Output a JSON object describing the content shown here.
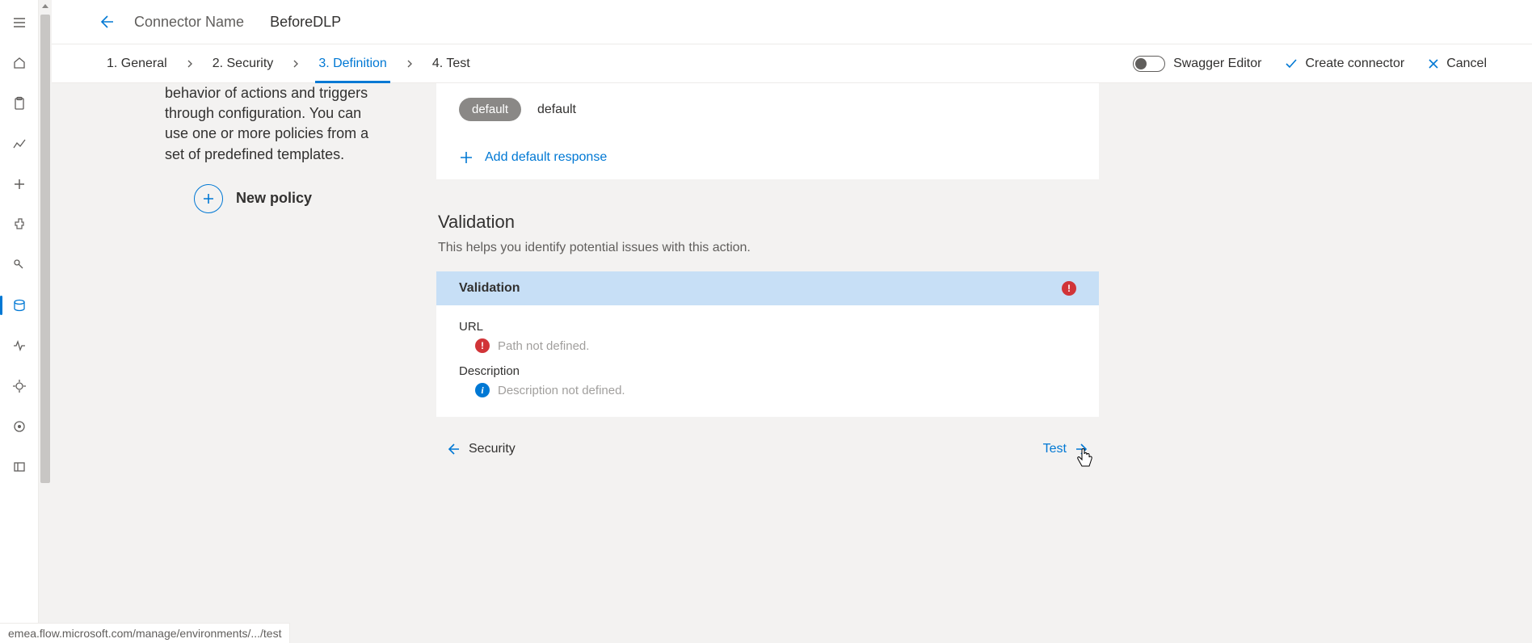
{
  "header": {
    "label": "Connector Name",
    "value": "BeforeDLP"
  },
  "tabs": {
    "general": "1. General",
    "security": "2. Security",
    "definition": "3. Definition",
    "test": "4. Test"
  },
  "toolbar": {
    "swagger": "Swagger Editor",
    "create": "Create connector",
    "cancel": "Cancel"
  },
  "policy": {
    "text": "behavior of actions and triggers through configuration. You can use one or more policies from a set of predefined templates.",
    "new_label": "New policy"
  },
  "response": {
    "pill": "default",
    "label": "default",
    "add": "Add default response"
  },
  "validation": {
    "title": "Validation",
    "desc": "This helps you identify potential issues with this action.",
    "header": "Validation",
    "url_label": "URL",
    "url_msg": "Path not defined.",
    "desc_label": "Description",
    "desc_msg": "Description not defined."
  },
  "nav": {
    "prev": "Security",
    "next": "Test"
  },
  "status_url": "emea.flow.microsoft.com/manage/environments/.../test",
  "icons": {
    "hamburger": "hamburger-icon",
    "home": "home-icon",
    "clipboard": "clipboard-icon",
    "flow": "flow-icon",
    "plus": "plus-icon",
    "puzzle": "puzzle-icon",
    "connector": "connector-icon",
    "data": "data-icon",
    "monitor": "monitor-icon",
    "ai": "ai-icon",
    "solutions": "solutions-icon",
    "collapse": "collapse-icon"
  }
}
